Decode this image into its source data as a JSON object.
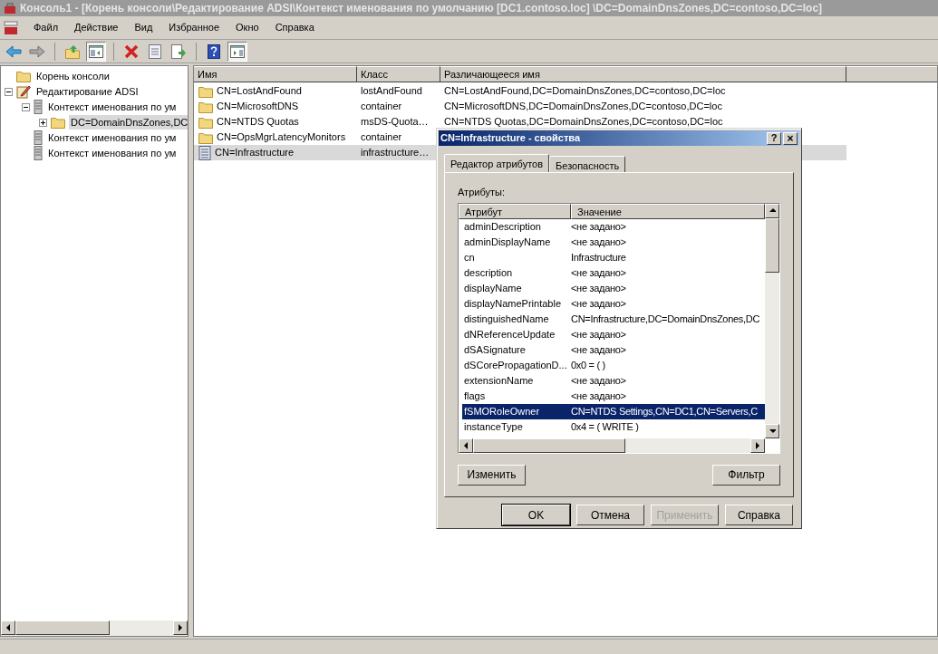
{
  "window": {
    "title": "Консоль1 - [Корень консоли\\Редактирование ADSI\\Контекст именования по умолчанию [DC1.contoso.loc] \\DC=DomainDnsZones,DC=contoso,DC=loc]"
  },
  "menu": [
    "Файл",
    "Действие",
    "Вид",
    "Избранное",
    "Окно",
    "Справка"
  ],
  "toolbar": [
    {
      "buttons": [
        {
          "kind": "back",
          "on": false
        },
        {
          "kind": "forward",
          "on": false
        }
      ]
    },
    {
      "buttons": [
        {
          "kind": "up",
          "on": false
        },
        {
          "kind": "tree",
          "on": true
        }
      ]
    },
    {
      "buttons": [
        {
          "kind": "delete",
          "on": false
        },
        {
          "kind": "properties",
          "on": false
        },
        {
          "kind": "export",
          "on": false
        }
      ]
    },
    {
      "buttons": [
        {
          "kind": "help",
          "on": false
        },
        {
          "kind": "action",
          "on": true
        }
      ]
    }
  ],
  "tree": [
    {
      "label": "Корень консоли",
      "kind": "folder",
      "selected": false
    },
    {
      "label": "Редактирование ADSI",
      "kind": "adsi",
      "selected": false,
      "expanded": true,
      "children": [
        {
          "label": "Контекст именования по ум",
          "kind": "server",
          "selected": false,
          "expanded": true,
          "children": [
            {
              "label": "DC=DomainDnsZones,DC",
              "kind": "folder",
              "selected": true,
              "expanded": false
            }
          ]
        },
        {
          "label": "Контекст именования по ум",
          "kind": "server",
          "selected": false
        },
        {
          "label": "Контекст именования по ум",
          "kind": "server",
          "selected": false
        }
      ]
    }
  ],
  "list": {
    "columns": [
      "Имя",
      "Класс",
      "Различающееся имя"
    ],
    "rows": [
      {
        "kind": "folder",
        "name": "CN=LostAndFound",
        "class": "lostAndFound",
        "dn": "CN=LostAndFound,DC=DomainDnsZones,DC=contoso,DC=loc",
        "selected": false
      },
      {
        "kind": "folder",
        "name": "CN=MicrosoftDNS",
        "class": "container",
        "dn": "CN=MicrosoftDNS,DC=DomainDnsZones,DC=contoso,DC=loc",
        "selected": false
      },
      {
        "kind": "folder",
        "name": "CN=NTDS Quotas",
        "class": "msDS-Quota…",
        "dn": "CN=NTDS Quotas,DC=DomainDnsZones,DC=contoso,DC=loc",
        "selected": false
      },
      {
        "kind": "folder",
        "name": "CN=OpsMgrLatencyMonitors",
        "class": "container",
        "selected": false
      },
      {
        "kind": "object",
        "name": "CN=Infrastructure",
        "class": "infrastructure…",
        "selected": true
      }
    ]
  },
  "dialog": {
    "title": "CN=Infrastructure - свойства",
    "help": "?",
    "close": "×",
    "tabs": [
      {
        "label": "Редактор атрибутов",
        "selected": true
      },
      {
        "label": "Безопасность",
        "selected": false
      }
    ],
    "attributes_label": "Атрибуты:",
    "columns": [
      "Атрибут",
      "Значение"
    ],
    "rows": [
      {
        "attribute": "adminDescription",
        "value": "<не задано>",
        "selected": false
      },
      {
        "attribute": "adminDisplayName",
        "value": "<не задано>",
        "selected": false
      },
      {
        "attribute": "cn",
        "value": "Infrastructure",
        "selected": false
      },
      {
        "attribute": "description",
        "value": "<не задано>",
        "selected": false
      },
      {
        "attribute": "displayName",
        "value": "<не задано>",
        "selected": false
      },
      {
        "attribute": "displayNamePrintable",
        "value": "<не задано>",
        "selected": false
      },
      {
        "attribute": "distinguishedName",
        "value": "CN=Infrastructure,DC=DomainDnsZones,DC",
        "selected": false
      },
      {
        "attribute": "dNReferenceUpdate",
        "value": "<не задано>",
        "selected": false
      },
      {
        "attribute": "dSASignature",
        "value": "<не задано>",
        "selected": false
      },
      {
        "attribute": "dSCorePropagationD...",
        "value": "0x0 = ( )",
        "selected": false
      },
      {
        "attribute": "extensionName",
        "value": "<не задано>",
        "selected": false
      },
      {
        "attribute": "flags",
        "value": "<не задано>",
        "selected": false
      },
      {
        "attribute": "fSMORoleOwner",
        "value": "CN=NTDS Settings,CN=DC1,CN=Servers,C",
        "selected": true
      },
      {
        "attribute": "instanceType",
        "value": "0x4 = ( WRITE )",
        "selected": false
      }
    ],
    "edit_button": "Изменить",
    "filter_button": "Фильтр",
    "buttons": [
      {
        "label": "OK",
        "disabled": false,
        "default": true
      },
      {
        "label": "Отмена",
        "disabled": false,
        "default": false
      },
      {
        "label": "Применить",
        "disabled": true,
        "default": false
      },
      {
        "label": "Справка",
        "disabled": false,
        "default": false
      }
    ]
  }
}
